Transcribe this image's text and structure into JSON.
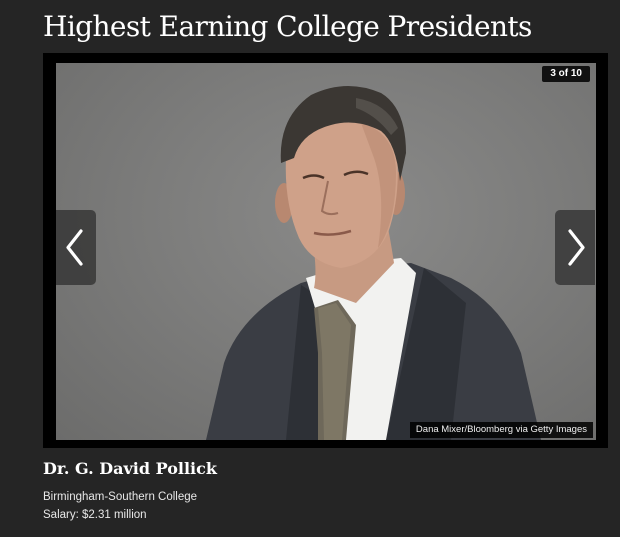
{
  "page": {
    "title": "Highest Earning College Presidents"
  },
  "slideshow": {
    "counter": "3 of 10",
    "photo_credit": "Dana Mixer/Bloomberg via Getty Images",
    "prev_icon": "chevron-left-icon",
    "next_icon": "chevron-right-icon"
  },
  "caption": {
    "name": "Dr. G. David Pollick",
    "college": "Birmingham-Southern College",
    "salary": "Salary: $2.31 million"
  },
  "colors": {
    "background": "#252525",
    "frame": "#000000",
    "text": "#ffffff"
  }
}
